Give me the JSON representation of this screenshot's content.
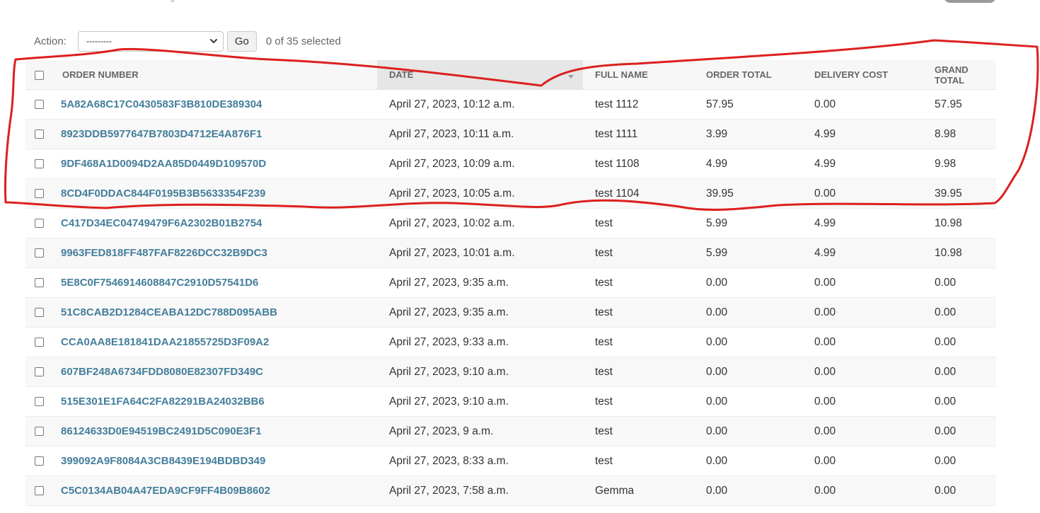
{
  "actions": {
    "label": "Action:",
    "selected_option": "---------",
    "go_label": "Go",
    "counter": "0 of 35 selected"
  },
  "table": {
    "columns": [
      "ORDER NUMBER",
      "DATE",
      "FULL NAME",
      "ORDER TOTAL",
      "DELIVERY COST",
      "GRAND TOTAL"
    ],
    "sorted_column": "DATE",
    "rows": [
      {
        "order_number": "5A82A68C17C0430583F3B810DE389304",
        "date": "April 27, 2023, 10:12 a.m.",
        "full_name": "test 1112",
        "order_total": "57.95",
        "delivery_cost": "0.00",
        "grand_total": "57.95"
      },
      {
        "order_number": "8923DDB5977647B7803D4712E4A876F1",
        "date": "April 27, 2023, 10:11 a.m.",
        "full_name": "test 1111",
        "order_total": "3.99",
        "delivery_cost": "4.99",
        "grand_total": "8.98"
      },
      {
        "order_number": "9DF468A1D0094D2AA85D0449D109570D",
        "date": "April 27, 2023, 10:09 a.m.",
        "full_name": "test 1108",
        "order_total": "4.99",
        "delivery_cost": "4.99",
        "grand_total": "9.98"
      },
      {
        "order_number": "8CD4F0DDAC844F0195B3B5633354F239",
        "date": "April 27, 2023, 10:05 a.m.",
        "full_name": "test 1104",
        "order_total": "39.95",
        "delivery_cost": "0.00",
        "grand_total": "39.95"
      },
      {
        "order_number": "C417D34EC04749479F6A2302B01B2754",
        "date": "April 27, 2023, 10:02 a.m.",
        "full_name": "test",
        "order_total": "5.99",
        "delivery_cost": "4.99",
        "grand_total": "10.98"
      },
      {
        "order_number": "9963FED818FF487FAF8226DCC32B9DC3",
        "date": "April 27, 2023, 10:01 a.m.",
        "full_name": "test",
        "order_total": "5.99",
        "delivery_cost": "4.99",
        "grand_total": "10.98"
      },
      {
        "order_number": "5E8C0F7546914608847C2910D57541D6",
        "date": "April 27, 2023, 9:35 a.m.",
        "full_name": "test",
        "order_total": "0.00",
        "delivery_cost": "0.00",
        "grand_total": "0.00"
      },
      {
        "order_number": "51C8CAB2D1284CEABA12DC788D095ABB",
        "date": "April 27, 2023, 9:35 a.m.",
        "full_name": "test",
        "order_total": "0.00",
        "delivery_cost": "0.00",
        "grand_total": "0.00"
      },
      {
        "order_number": "CCA0AA8E181841DAA21855725D3F09A2",
        "date": "April 27, 2023, 9:33 a.m.",
        "full_name": "test",
        "order_total": "0.00",
        "delivery_cost": "0.00",
        "grand_total": "0.00"
      },
      {
        "order_number": "607BF248A6734FDD8080E82307FD349C",
        "date": "April 27, 2023, 9:10 a.m.",
        "full_name": "test",
        "order_total": "0.00",
        "delivery_cost": "0.00",
        "grand_total": "0.00"
      },
      {
        "order_number": "515E301E1FA64C2FA82291BA24032BB6",
        "date": "April 27, 2023, 9:10 a.m.",
        "full_name": "test",
        "order_total": "0.00",
        "delivery_cost": "0.00",
        "grand_total": "0.00"
      },
      {
        "order_number": "86124633D0E94519BC2491D5C090E3F1",
        "date": "April 27, 2023, 9 a.m.",
        "full_name": "test",
        "order_total": "0.00",
        "delivery_cost": "0.00",
        "grand_total": "0.00"
      },
      {
        "order_number": "399092A9F8084A3CB8439E194BDBD349",
        "date": "April 27, 2023, 8:33 a.m.",
        "full_name": "test",
        "order_total": "0.00",
        "delivery_cost": "0.00",
        "grand_total": "0.00"
      },
      {
        "order_number": "C5C0134AB04A47EDA9CF9FF4B09B8602",
        "date": "April 27, 2023, 7:58 a.m.",
        "full_name": "Gemma",
        "order_total": "0.00",
        "delivery_cost": "0.00",
        "grand_total": "0.00"
      }
    ]
  },
  "colors": {
    "link": "#447e9b",
    "header_bg": "#f7f7f7",
    "sorted_header_bg": "#e6e6e6",
    "annotation": "#dd1f1f"
  },
  "icons": {
    "select_chevron": "chevron-down-icon",
    "sort_indicator": "sort-icon"
  }
}
